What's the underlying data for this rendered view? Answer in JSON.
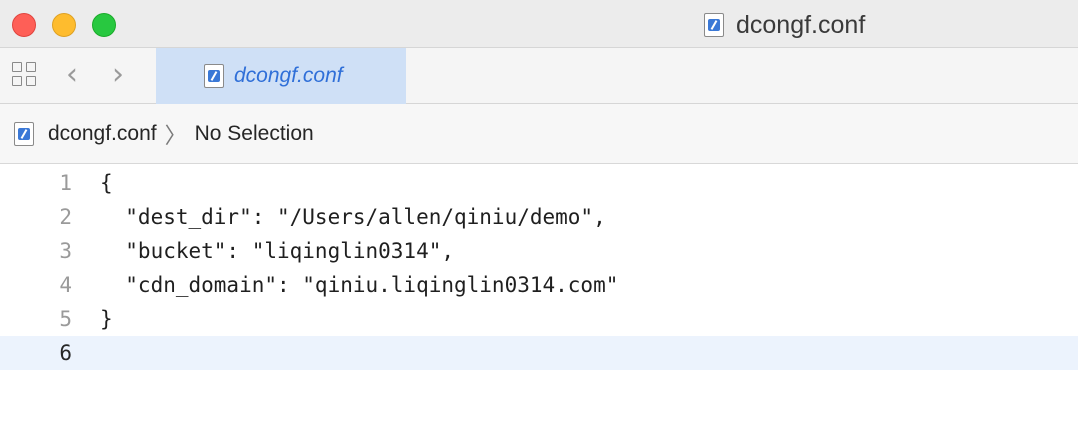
{
  "window": {
    "title": "dcongf.conf",
    "icon": "conf-file-icon"
  },
  "toolbar": {
    "grid_icon": "grid-icon",
    "back_icon": "‹",
    "forward_icon": "›",
    "tab_label": "dcongf.conf"
  },
  "breadcrumb": {
    "file": "dcongf.conf",
    "separator": "〉",
    "selection": "No Selection"
  },
  "editor": {
    "current_line": 6,
    "lines": [
      {
        "number": "1",
        "text": "{"
      },
      {
        "number": "2",
        "text": "  \"dest_dir\": \"/Users/allen/qiniu/demo\","
      },
      {
        "number": "3",
        "text": "  \"bucket\": \"liqinglin0314\","
      },
      {
        "number": "4",
        "text": "  \"cdn_domain\": \"qiniu.liqinglin0314.com\""
      },
      {
        "number": "5",
        "text": "}"
      },
      {
        "number": "6",
        "text": ""
      }
    ]
  },
  "colors": {
    "tab_background": "#cfe0f6",
    "tab_text": "#2f6fd8",
    "current_line": "#ecf3fd"
  }
}
